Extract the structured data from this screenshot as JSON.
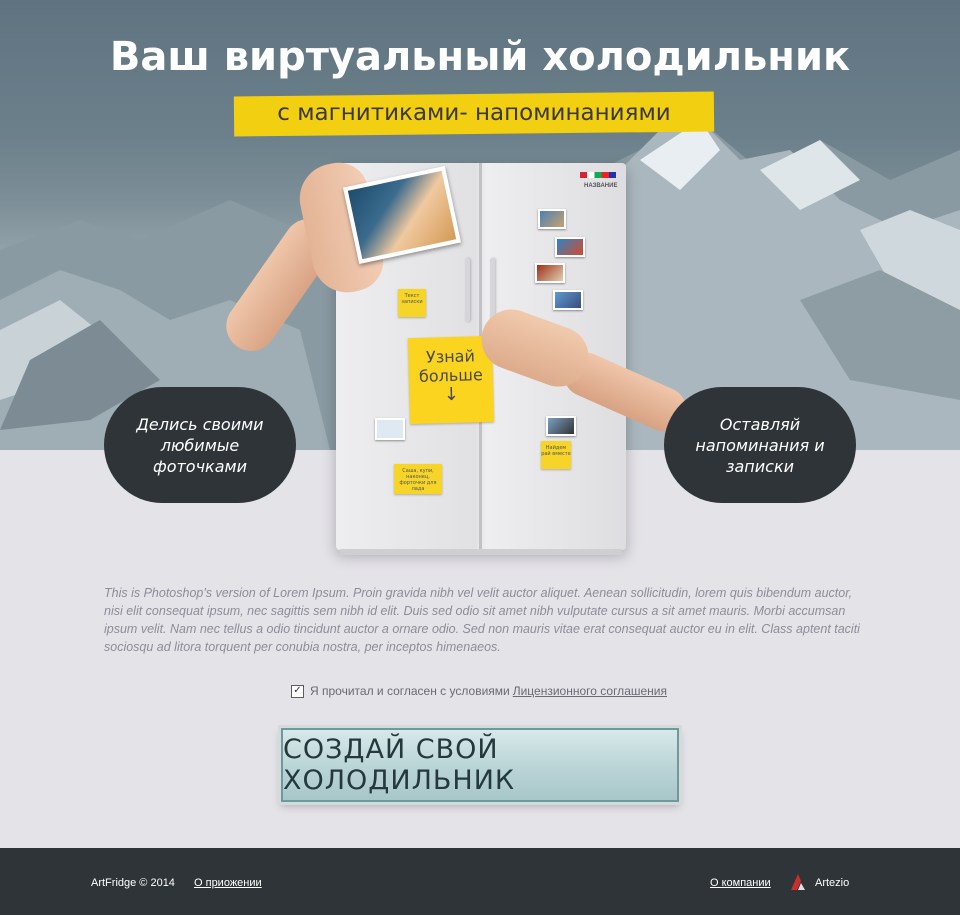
{
  "header": {
    "title": "Ваш виртуальный холодильник",
    "subtitle": "с магнитиками- напоминаниями"
  },
  "fridge": {
    "name_label": "НАЗВАНИЕ",
    "note_small_1": "Текст записки",
    "note_big": "Узнай больше",
    "note_big_arrow": "↓",
    "note_small_2": "Саша, купи, наконец, форточки для лада",
    "note_small_3": "Найдем рай вместе"
  },
  "bubbles": {
    "left": "Делись своими любимые фоточками",
    "right": "Оставляй напоминания и записки"
  },
  "description": "This is Photoshop's version  of Lorem Ipsum. Proin gravida nibh vel velit auctor aliquet. Aenean sollicitudin, lorem quis bibendum auctor, nisi elit consequat ipsum, nec sagittis sem nibh id elit. Duis sed odio sit amet nibh vulputate cursus a sit amet mauris. Morbi accumsan ipsum velit. Nam nec tellus a odio tincidunt auctor a ornare odio. Sed non  mauris vitae erat consequat auctor eu in elit. Class aptent taciti sociosqu ad litora torquent per conubia nostra, per inceptos himenaeos.",
  "agreement": {
    "checked": true,
    "checkmark": "✓",
    "text": "Я прочитал и согласен с условиями",
    "link": "Лицензионного соглашения"
  },
  "cta_label": "СОЗДАЙ СВОЙ ХОЛОДИЛЬНИК",
  "footer": {
    "copyright": "ArtFridge © 2014",
    "about_link": "О приожении",
    "company_link": "О компании",
    "brand": "Artezio"
  },
  "colors": {
    "accent_yellow": "#f3cf11",
    "bubble_dark": "#2f3438",
    "cta_teal": "#b9d4d6",
    "footer_bg": "#2e3437"
  },
  "icons": {
    "checkbox": "check-icon",
    "down_arrow": "arrow-down-icon",
    "brand_logo": "artezio-logo-icon"
  }
}
